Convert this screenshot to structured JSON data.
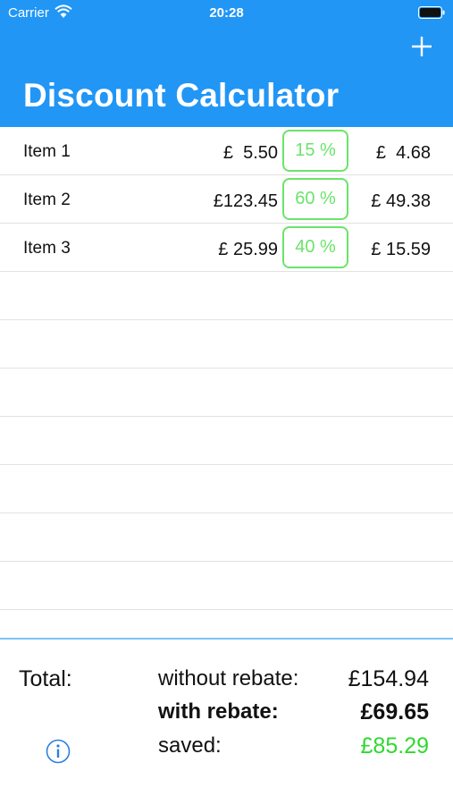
{
  "status_bar": {
    "carrier": "Carrier",
    "time": "20:28"
  },
  "header": {
    "title": "Discount Calculator",
    "add_icon": "plus-icon"
  },
  "items": [
    {
      "name": "Item 1",
      "price": "£  5.50",
      "discount": "15 %",
      "final": "£  4.68"
    },
    {
      "name": "Item 2",
      "price": "£123.45",
      "discount": "60 %",
      "final": "£ 49.38"
    },
    {
      "name": "Item 3",
      "price": "£ 25.99",
      "discount": "40 %",
      "final": "£ 15.59"
    }
  ],
  "footer": {
    "total_label": "Total:",
    "without_rebate_label": "without rebate:",
    "without_rebate_value": "£154.94",
    "with_rebate_label": "with rebate:",
    "with_rebate_value": "£69.65",
    "saved_label": "saved:",
    "saved_value": "£85.29",
    "info_icon": "info-icon"
  },
  "colors": {
    "header": "#2196f5",
    "discount_border": "#6be36b",
    "saved_value": "#2fd92f",
    "divider": "#7cc4f7"
  }
}
